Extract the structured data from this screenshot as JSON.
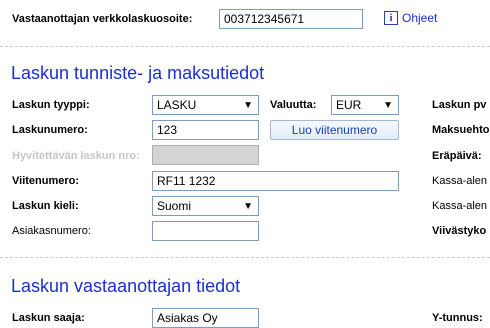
{
  "top": {
    "address_label": "Vastaanottajan verkkolaskuosoite:",
    "address_value": "003712345671",
    "help_icon": "i",
    "help_link": "Ohjeet"
  },
  "invoice": {
    "title": "Laskun tunniste- ja maksutiedot",
    "type_label": "Laskun tyyppi:",
    "type_value": "LASKU",
    "currency_label": "Valuutta:",
    "currency_value": "EUR",
    "number_label": "Laskunumero:",
    "number_value": "123",
    "generate_ref_button": "Luo viitenumero",
    "credited_label": "Hyvitettävän laskun nro:",
    "reference_label": "Viitenumero:",
    "reference_value": "RF11 1232",
    "language_label": "Laskun kieli:",
    "language_value": "Suomi",
    "customer_number_label": "Asiakasnumero:",
    "customer_number_value": "",
    "right_col": [
      "Laskun pv",
      "Maksuehto",
      "Eräpäivä:",
      "Kassa-alen",
      "Kassa-alen",
      "Viivästyko"
    ]
  },
  "recipient": {
    "title": "Laskun vastaanottajan tiedot",
    "payer_label": "Laskun saaja:",
    "payer_value": "Asiakas Oy",
    "business_id_label": "Y-tunnus:"
  },
  "colors": {
    "section_title": "#1b2fd6",
    "disabled_field": "#d4d4d4"
  },
  "icons": [
    "info-icon",
    "dropdown-arrow-icon"
  ]
}
